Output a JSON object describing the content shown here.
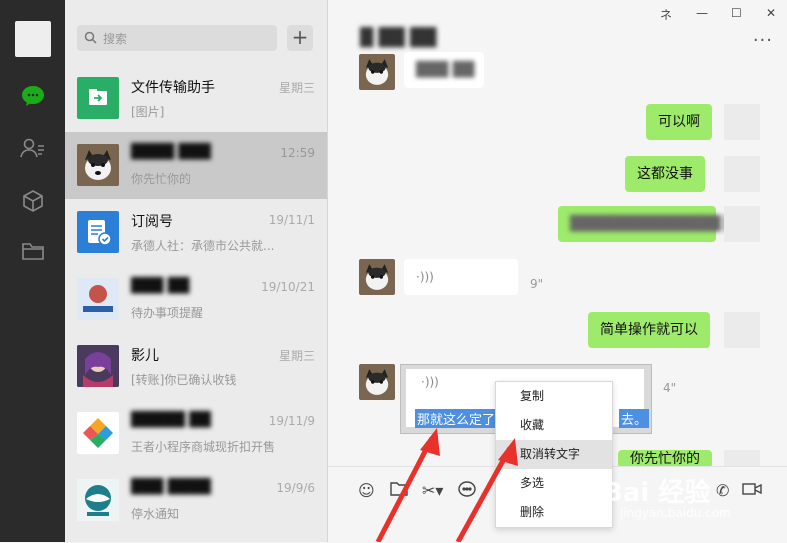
{
  "search": {
    "placeholder": "搜索"
  },
  "conversations": [
    {
      "name": "文件传输助手",
      "preview": "[图片]",
      "time": "星期三"
    },
    {
      "name": "",
      "preview": "你先忙你的",
      "time": "12:59"
    },
    {
      "name": "订阅号",
      "preview": "承德人社：承德市公共就...",
      "time": "19/11/1"
    },
    {
      "name": "",
      "preview": "待办事项提醒",
      "time": "19/10/21"
    },
    {
      "name": "影儿",
      "preview": "[转账]你已确认收钱",
      "time": "星期三"
    },
    {
      "name": "",
      "preview": "王者小程序商城现折扣开售",
      "time": "19/11/9"
    },
    {
      "name": "",
      "preview": "停水通知",
      "time": "19/9/6"
    }
  ],
  "window": {
    "pin": "ネ",
    "min": "—",
    "max": "☐",
    "close": "✕",
    "more": "···"
  },
  "messages": {
    "m1": "可以啊",
    "m2": "这都没事",
    "m3": "简单操作就可以",
    "voice1_duration": "9\"",
    "voice2_duration": "4\"",
    "transcript": "那就这么定了",
    "transcript_tail": "去。",
    "partial": "你先忙你的"
  },
  "context_menu": [
    "复制",
    "收藏",
    "取消转文字",
    "多选",
    "删除"
  ],
  "watermark": {
    "brand": "Bai 经验",
    "url": "jingyan.baidu.com"
  },
  "colors": {
    "sidebar": "#2b2b2b",
    "green": "#9eea6a",
    "accent": "#1aad19"
  }
}
